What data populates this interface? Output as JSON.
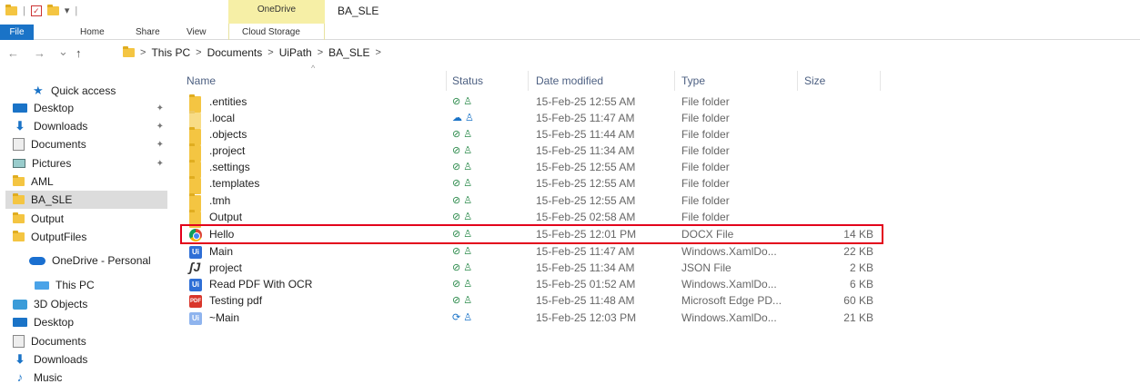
{
  "titlebar": {
    "qat_sep": "|",
    "qat_check": "✓",
    "qat_more": "▾",
    "context_tab": "OneDrive",
    "window_title": "BA_SLE"
  },
  "ribbon": {
    "tabs": [
      "File",
      "Home",
      "Share",
      "View",
      "Cloud Storage"
    ]
  },
  "nav": {
    "back": "←",
    "forward": "→",
    "recent": "⌄",
    "up": "↑",
    "breadcrumb": [
      "This PC",
      "Documents",
      "UiPath",
      "BA_SLE"
    ],
    "crumb_sep": ">"
  },
  "sidebar": {
    "pin_glyph": "✦",
    "items": [
      {
        "label": "Quick access",
        "icon": "star-icon"
      },
      {
        "label": "Desktop",
        "icon": "desktop-icon",
        "pinned": true
      },
      {
        "label": "Downloads",
        "icon": "download-icon",
        "pinned": true
      },
      {
        "label": "Documents",
        "icon": "documents-icon",
        "pinned": true
      },
      {
        "label": "Pictures",
        "icon": "pictures-icon",
        "pinned": true
      },
      {
        "label": "AML",
        "icon": "folder-icon"
      },
      {
        "label": "BA_SLE",
        "icon": "folder-icon",
        "selected": true
      },
      {
        "label": "Output",
        "icon": "folder-icon"
      },
      {
        "label": "OutputFiles",
        "icon": "folder-icon"
      },
      {
        "label": "OneDrive - Personal",
        "icon": "onedrive-cloud-icon"
      },
      {
        "label": "This PC",
        "icon": "this-pc-icon"
      },
      {
        "label": "3D Objects",
        "icon": "3d-objects-icon"
      },
      {
        "label": "Desktop",
        "icon": "desktop-icon"
      },
      {
        "label": "Documents",
        "icon": "documents-icon"
      },
      {
        "label": "Downloads",
        "icon": "download-icon"
      },
      {
        "label": "Music",
        "icon": "music-icon"
      }
    ]
  },
  "columns": {
    "name": "Name",
    "status": "Status",
    "date": "Date modified",
    "type": "Type",
    "size": "Size",
    "sort_indicator": "^"
  },
  "files": [
    {
      "name": ".entities",
      "status": "⊘ ♙",
      "date": "15-Feb-25 12:55 AM",
      "type": "File folder",
      "size": "",
      "icon": "folder-icon"
    },
    {
      "name": ".local",
      "status": "☁ ♙",
      "date": "15-Feb-25 11:47 AM",
      "type": "File folder",
      "size": "",
      "icon": "folder-icon"
    },
    {
      "name": ".objects",
      "status": "⊘ ♙",
      "date": "15-Feb-25 11:44 AM",
      "type": "File folder",
      "size": "",
      "icon": "folder-icon"
    },
    {
      "name": ".project",
      "status": "⊘ ♙",
      "date": "15-Feb-25 11:34 AM",
      "type": "File folder",
      "size": "",
      "icon": "folder-icon"
    },
    {
      "name": ".settings",
      "status": "⊘ ♙",
      "date": "15-Feb-25 12:55 AM",
      "type": "File folder",
      "size": "",
      "icon": "folder-icon"
    },
    {
      "name": ".templates",
      "status": "⊘ ♙",
      "date": "15-Feb-25 12:55 AM",
      "type": "File folder",
      "size": "",
      "icon": "folder-icon"
    },
    {
      "name": ".tmh",
      "status": "⊘ ♙",
      "date": "15-Feb-25 12:55 AM",
      "type": "File folder",
      "size": "",
      "icon": "folder-icon"
    },
    {
      "name": "Output",
      "status": "⊘ ♙",
      "date": "15-Feb-25 02:58 AM",
      "type": "File folder",
      "size": "",
      "icon": "folder-icon"
    },
    {
      "name": "Hello",
      "status": "⊘ ♙",
      "date": "15-Feb-25 12:01 PM",
      "type": "DOCX File",
      "size": "14 KB",
      "icon": "chrome-icon",
      "highlighted": true
    },
    {
      "name": "Main",
      "status": "⊘ ♙",
      "date": "15-Feb-25 11:47 AM",
      "type": "Windows.XamlDo...",
      "size": "22 KB",
      "icon": "uipath-icon",
      "icon_text": "Ui"
    },
    {
      "name": "project",
      "status": "⊘ ♙",
      "date": "15-Feb-25 11:34 AM",
      "type": "JSON File",
      "size": "2 KB",
      "icon": "json-icon",
      "icon_text": "ʃJ"
    },
    {
      "name": "Read PDF With OCR",
      "status": "⊘ ♙",
      "date": "15-Feb-25 01:52 AM",
      "type": "Windows.XamlDo...",
      "size": "6 KB",
      "icon": "uipath-icon",
      "icon_text": "Ui"
    },
    {
      "name": "Testing pdf",
      "status": "⊘ ♙",
      "date": "15-Feb-25 11:48 AM",
      "type": "Microsoft Edge PD...",
      "size": "60 KB",
      "icon": "pdf-icon",
      "icon_text": "PDF"
    },
    {
      "name": "~Main",
      "status": "⟳ ♙",
      "date": "15-Feb-25 12:03 PM",
      "type": "Windows.XamlDo...",
      "size": "21 KB",
      "icon": "uipath-icon",
      "icon_text": "Ui"
    }
  ],
  "colors": {
    "accent": "#1a73c7",
    "highlight_border": "#e3001b",
    "context_tab_bg": "#f6efa6",
    "status_green": "#2a8a4a",
    "folder": "#f4c542"
  }
}
